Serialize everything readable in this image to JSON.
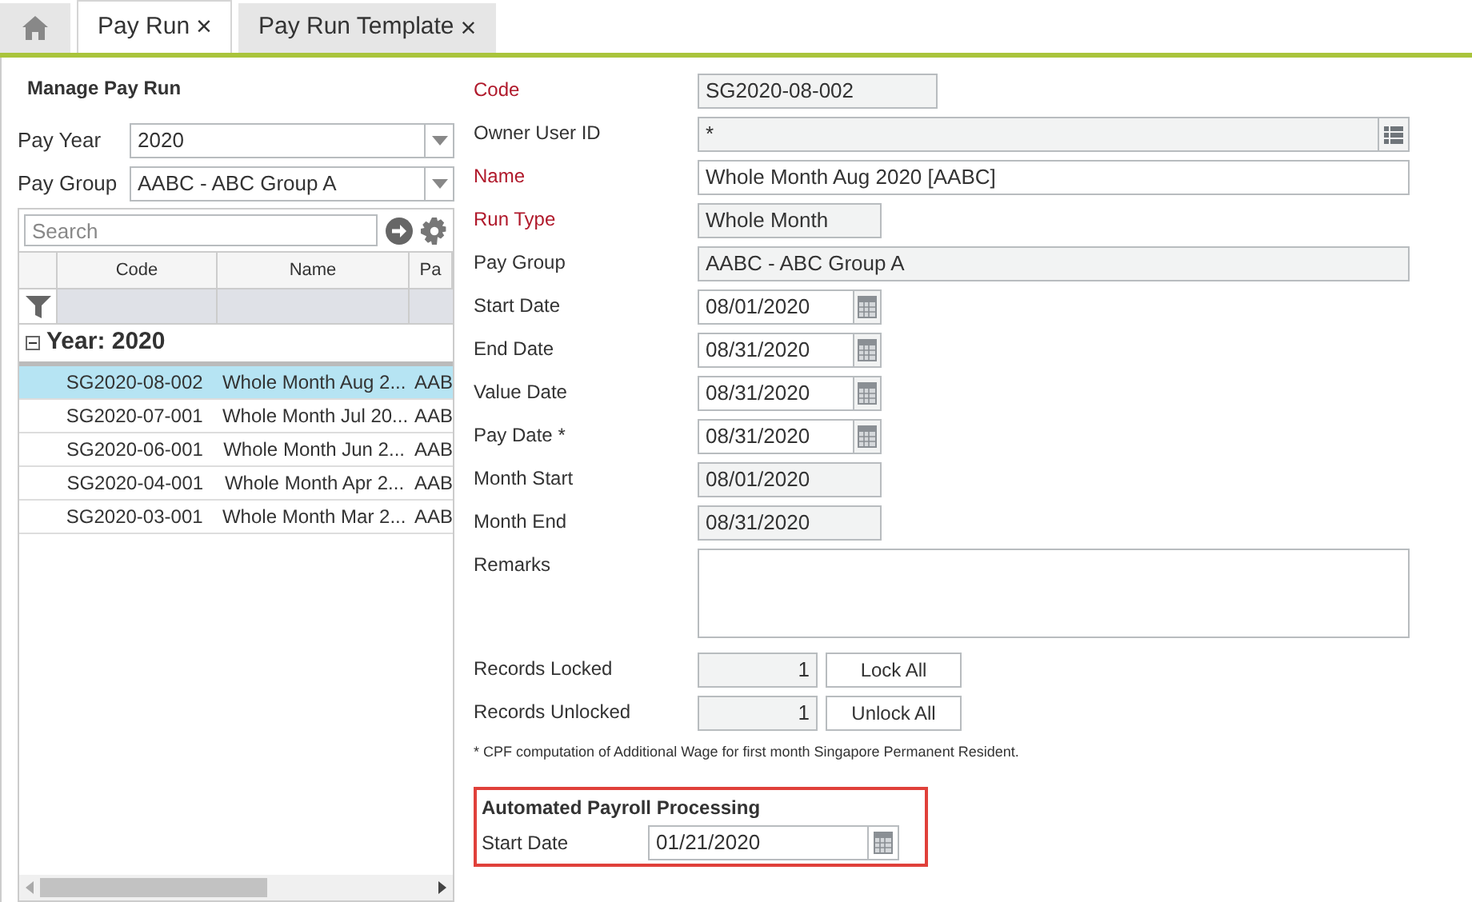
{
  "tabs": [
    {
      "kind": "home",
      "selected": false
    },
    {
      "kind": "text",
      "label": "Pay Run",
      "close": "×",
      "selected": true
    },
    {
      "kind": "text",
      "label": "Pay Run Template",
      "close": "×",
      "selected": false
    }
  ],
  "title": "Manage Pay Run",
  "filters": [
    {
      "label": "Pay Year",
      "value": "2020"
    },
    {
      "label": "Pay Group",
      "value": "AABC - ABC Group A"
    }
  ],
  "grid": {
    "search_placeholder": "Search",
    "columns": [
      "Code",
      "Name",
      "Pa"
    ],
    "group": "Year: 2020",
    "rows": [
      {
        "cells": [
          "SG2020-08-002",
          "Whole Month Aug 2...",
          "AAB"
        ],
        "selected": true
      },
      {
        "cells": [
          "SG2020-07-001",
          "Whole Month Jul 20...",
          "AAB"
        ],
        "selected": false
      },
      {
        "cells": [
          "SG2020-06-001",
          "Whole Month Jun 2...",
          "AAB"
        ],
        "selected": false
      },
      {
        "cells": [
          "SG2020-04-001",
          "Whole Month Apr 2...",
          "AAB"
        ],
        "selected": false
      },
      {
        "cells": [
          "SG2020-03-001",
          "Whole Month Mar 2...",
          "AAB"
        ],
        "selected": false
      }
    ]
  },
  "form": [
    {
      "label": "Code",
      "required": true,
      "kind": "code",
      "value": "SG2020-08-002"
    },
    {
      "label": "Owner User ID",
      "required": false,
      "kind": "lookup",
      "value": "*"
    },
    {
      "label": "Name",
      "required": true,
      "kind": "text",
      "value": "Whole Month Aug 2020 [AABC]"
    },
    {
      "label": "Run Type",
      "required": true,
      "kind": "type",
      "value": "Whole Month"
    },
    {
      "label": "Pay Group",
      "required": false,
      "kind": "readonly",
      "value": "AABC - ABC Group A"
    },
    {
      "label": "Start Date",
      "required": false,
      "kind": "date",
      "value": "08/01/2020"
    },
    {
      "label": "End Date",
      "required": false,
      "kind": "date",
      "value": "08/31/2020"
    },
    {
      "label": "Value Date",
      "required": false,
      "kind": "date",
      "value": "08/31/2020"
    },
    {
      "label": "Pay Date *",
      "required": false,
      "kind": "date",
      "value": "08/31/2020"
    },
    {
      "label": "Month Start",
      "required": false,
      "kind": "period",
      "value": "08/01/2020"
    },
    {
      "label": "Month End",
      "required": false,
      "kind": "period",
      "value": "08/31/2020"
    },
    {
      "label": "Remarks",
      "required": false,
      "kind": "textarea"
    },
    {
      "label": "Records Locked",
      "required": false,
      "kind": "counter",
      "value": "1",
      "button": "Lock All"
    },
    {
      "label": "Records Unlocked",
      "required": false,
      "kind": "counter",
      "value": "1",
      "button": "Unlock All"
    }
  ],
  "footnote": "* CPF computation of Additional Wage for first month Singapore Permanent Resident.",
  "automated": {
    "title": "Automated Payroll Processing",
    "label": "Start Date",
    "value": "01/21/2020"
  }
}
